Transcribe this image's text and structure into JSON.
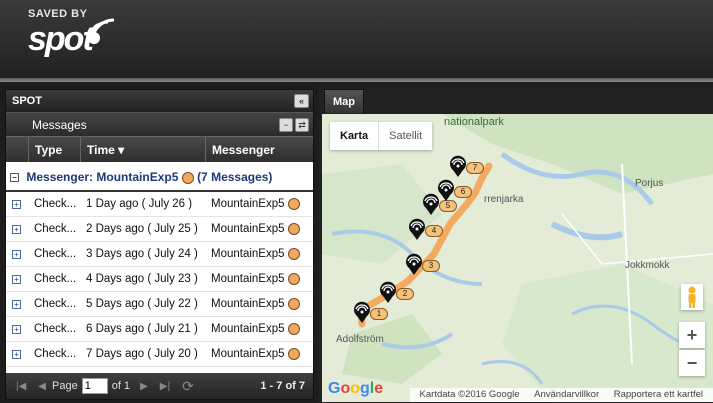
{
  "brand": {
    "saved_by": "SAVED BY",
    "name": "spot",
    "tm": "™"
  },
  "panel": {
    "title": "SPOT",
    "subtitle": "Messages",
    "columns": [
      "Type",
      "Time ▾",
      "Messenger"
    ],
    "group": {
      "label": "Messenger: MountainExp5",
      "count": "(7 Messages)"
    },
    "rows": [
      {
        "type": "Check...",
        "time": "1 Day ago ( July 26 )",
        "messenger": "MountainExp5"
      },
      {
        "type": "Check...",
        "time": "2 Days ago ( July 25 )",
        "messenger": "MountainExp5"
      },
      {
        "type": "Check...",
        "time": "3 Days ago ( July 24 )",
        "messenger": "MountainExp5"
      },
      {
        "type": "Check...",
        "time": "4 Days ago ( July 23 )",
        "messenger": "MountainExp5"
      },
      {
        "type": "Check...",
        "time": "5 Days ago ( July 22 )",
        "messenger": "MountainExp5"
      },
      {
        "type": "Check...",
        "time": "6 Days ago ( July 21 )",
        "messenger": "MountainExp5"
      },
      {
        "type": "Check...",
        "time": "7 Days ago ( July 20 )",
        "messenger": "MountainExp5"
      }
    ],
    "footer": {
      "page_label": "Page",
      "page_value": "1",
      "of_label": "of 1",
      "count": "1 - 7 of 7"
    }
  },
  "map": {
    "tab": "Map",
    "types": [
      "Karta",
      "Satellit"
    ],
    "places": [
      "nationalpark",
      "rrenjarka",
      "Porjus",
      "Jokkmokk",
      "Adolfström"
    ],
    "markers": [
      "1",
      "2",
      "3",
      "4",
      "5",
      "6",
      "7"
    ],
    "zoom_in": "+",
    "zoom_out": "−",
    "google": "Google",
    "attribution": [
      "Kartdata ©2016 Google",
      "Användarvillkor",
      "Rapportera ett kartfel"
    ],
    "colors": {
      "route": "#f5a04a",
      "marker_label": "#f5c27a",
      "land": "#e7efe0",
      "water": "#a9cbe8"
    }
  }
}
